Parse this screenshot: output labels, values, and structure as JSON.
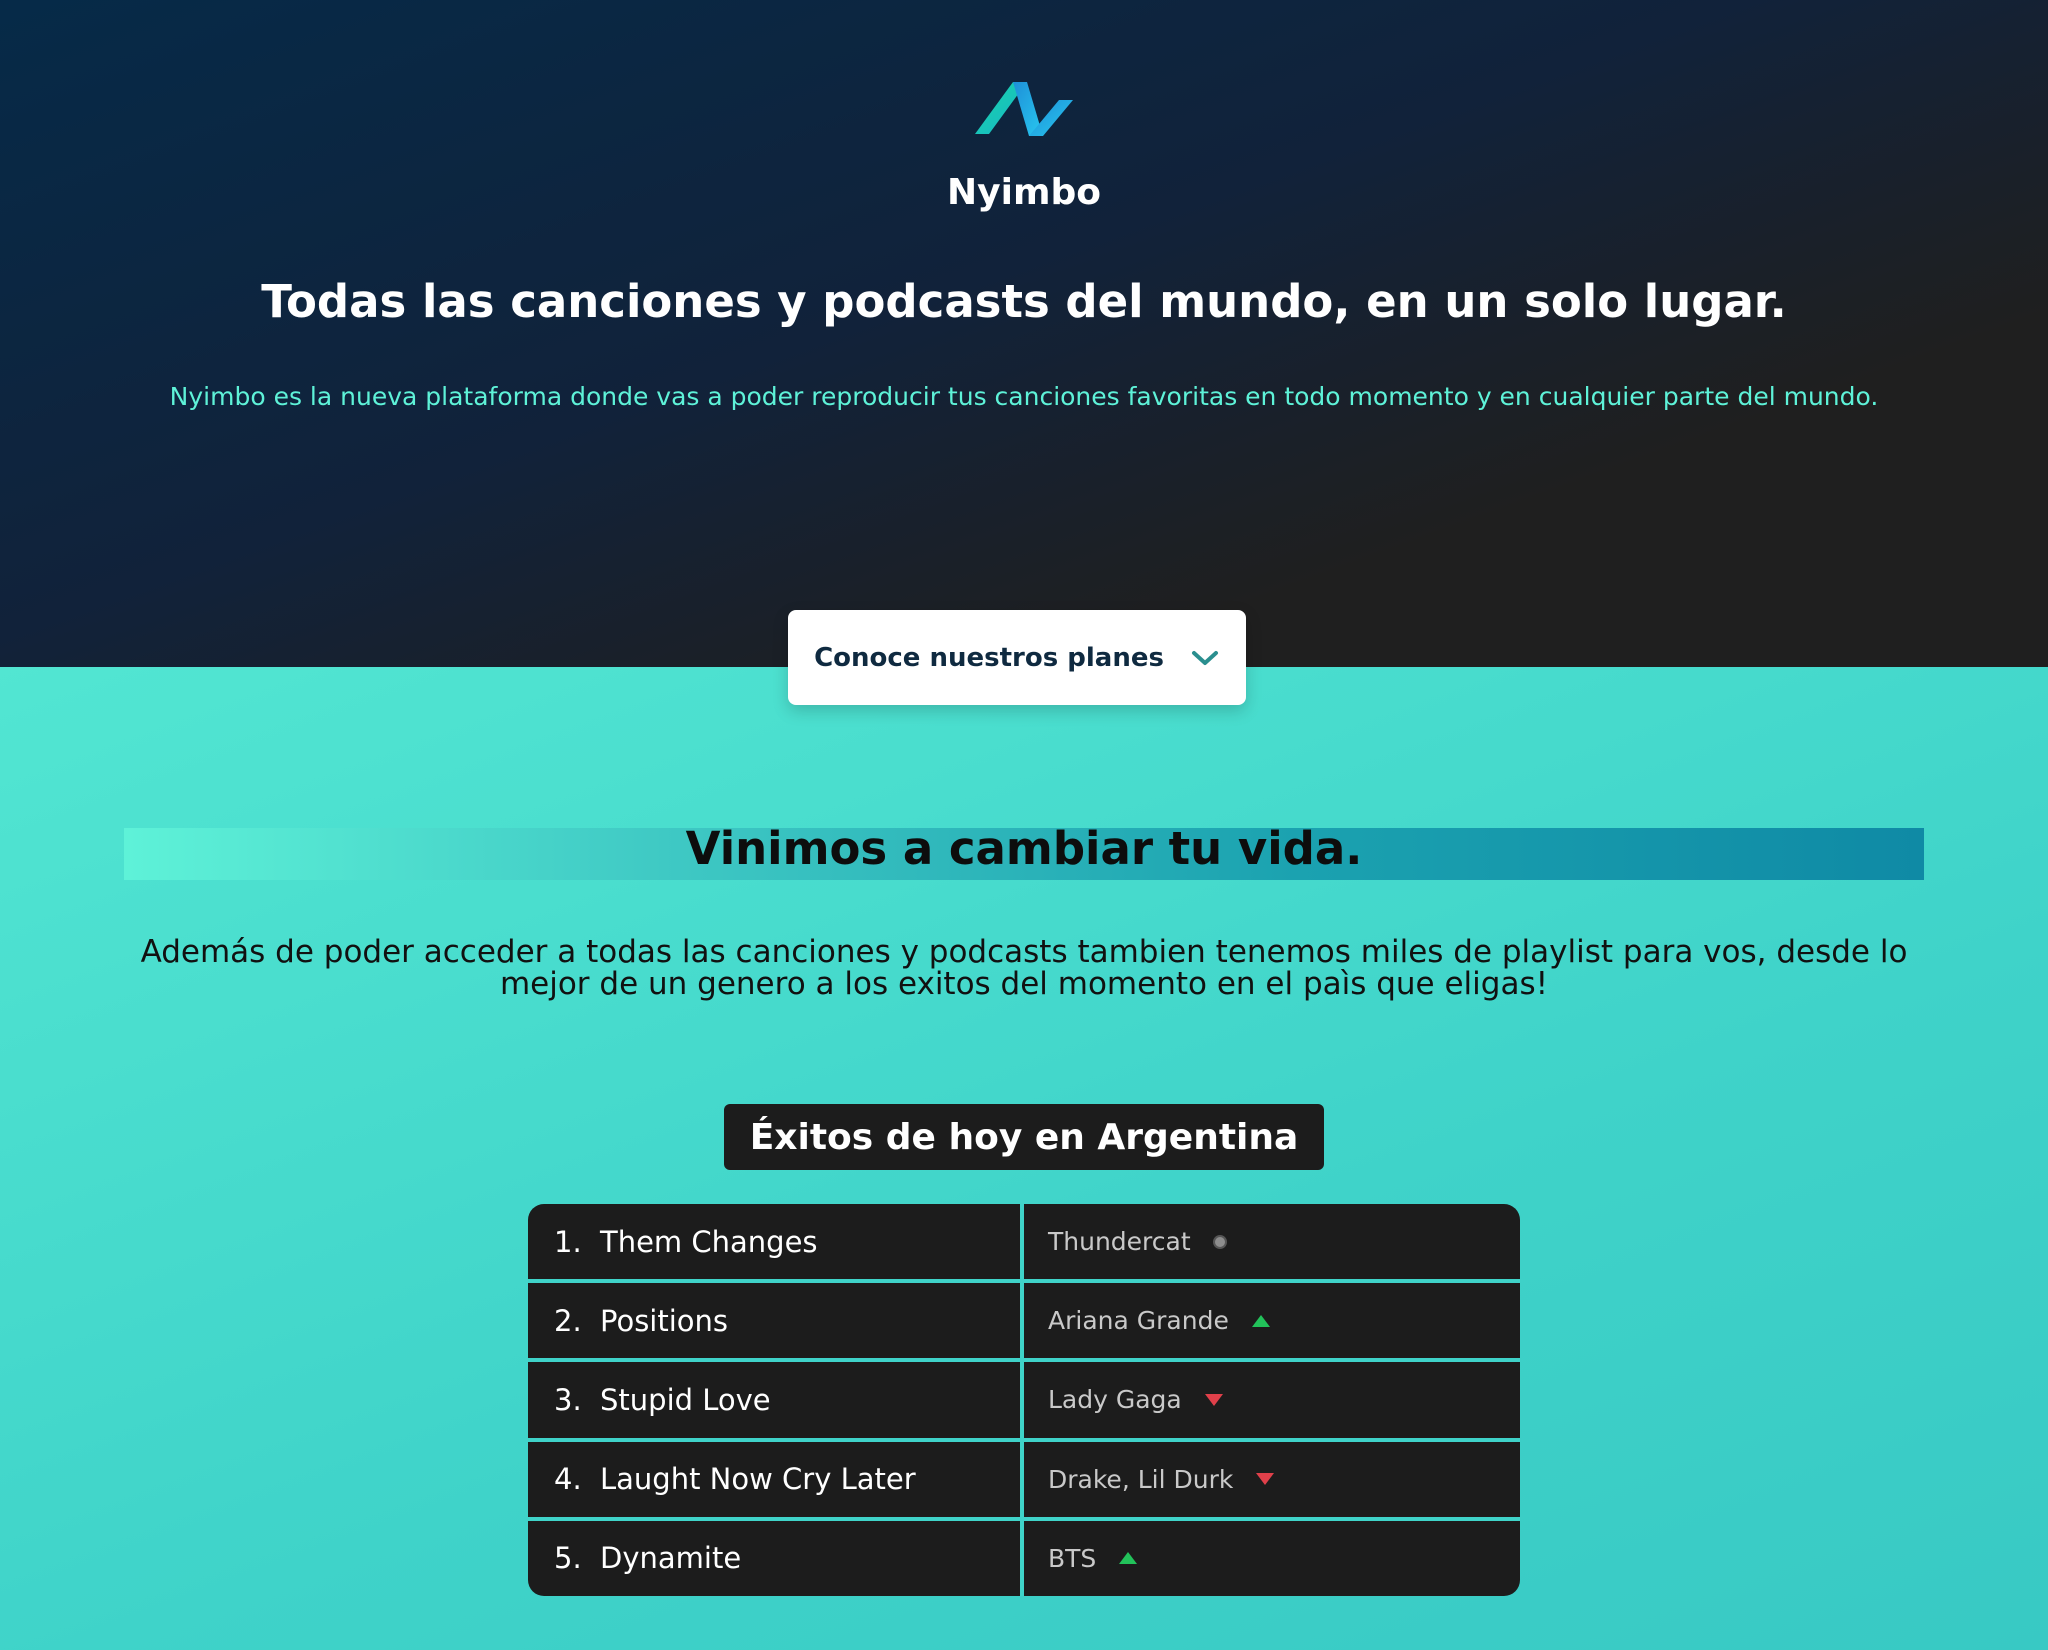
{
  "brand": {
    "name": "Nyimbo"
  },
  "hero": {
    "title": "Todas las canciones y podcasts del mundo, en un solo lugar.",
    "subtitle": "Nyimbo es la nueva plataforma donde vas a poder reproducir tus canciones favoritas en todo momento y en cualquier parte del mundo.",
    "button_label": "Conoce nuestros planes"
  },
  "section": {
    "title": "Vinimos a cambiar tu vida.",
    "description": "Además de poder acceder a todas las canciones y podcasts tambien tenemos miles de playlist para vos, desde lo mejor de un genero a los exitos del momento en el paìs que eligas!"
  },
  "chart": {
    "title": "Éxitos de hoy en Argentina",
    "rows": [
      {
        "rank": "1.",
        "song": "Them Changes",
        "artist": "Thundercat",
        "trend": "same"
      },
      {
        "rank": "2.",
        "song": "Positions",
        "artist": "Ariana Grande",
        "trend": "up"
      },
      {
        "rank": "3.",
        "song": "Stupid Love",
        "artist": "Lady Gaga",
        "trend": "down"
      },
      {
        "rank": "4.",
        "song": "Laught Now Cry Later",
        "artist": "Drake, Lil Durk",
        "trend": "down"
      },
      {
        "rank": "5.",
        "song": "Dynamite",
        "artist": "BTS",
        "trend": "up"
      }
    ]
  },
  "colors": {
    "accent": "#5ef2d8",
    "dark": "#1c1c1c",
    "up": "#22c25a",
    "down": "#e0404a"
  },
  "icons": {
    "logo": "nyimbo-logo-icon",
    "button": "chevron-down-icon",
    "same": "neutral-dot-icon",
    "up": "trend-up-icon",
    "down": "trend-down-icon"
  }
}
